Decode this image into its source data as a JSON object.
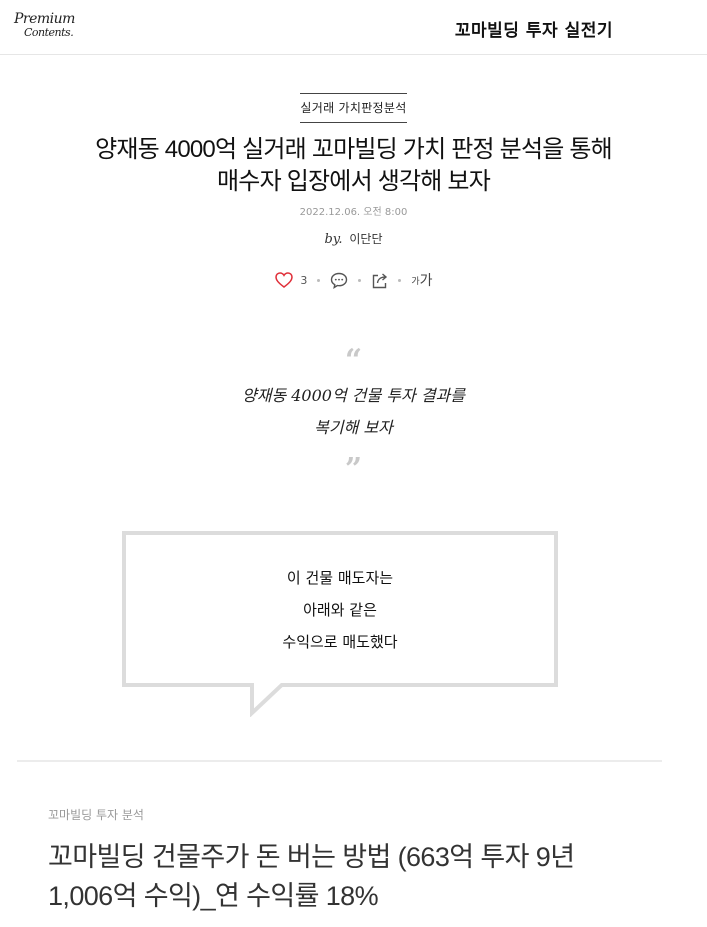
{
  "header": {
    "logo_line1": "Premium",
    "logo_line2": "Contents.",
    "series_title": "꼬마빌딩 투자 실전기"
  },
  "article": {
    "category": "실거래 가치판정분석",
    "title_line1": "양재동 4000억 실거래 꼬마빌딩 가치 판정 분석을 통해",
    "title_line2": "매수자 입장에서 생각해 보자",
    "date": "2022.12.06. 오전 8:00",
    "byline_prefix": "by.",
    "author": "이단단",
    "like_count": "3",
    "fontsize_small": "가",
    "fontsize_large": "가"
  },
  "quote": {
    "open_mark": "“",
    "close_mark": "”",
    "line1": "양재동 4000억 건물 투자 결과를",
    "line2": "복기해 보자"
  },
  "bubble": {
    "line1": "이 건물 매도자는",
    "line2": "아래와 같은",
    "line3": "수익으로 매도했다"
  },
  "recommended": {
    "category": "꼬마빌딩 투자 분석",
    "title_line1": "꼬마빌딩 건물주가 돈 버는 방법 (663억 투자 9년",
    "title_line2": "1,006억 수익)_연 수익률 18%"
  },
  "colors": {
    "heart": "#e0303a",
    "bubble_border": "#dcdcdc",
    "divider": "#ececec"
  }
}
